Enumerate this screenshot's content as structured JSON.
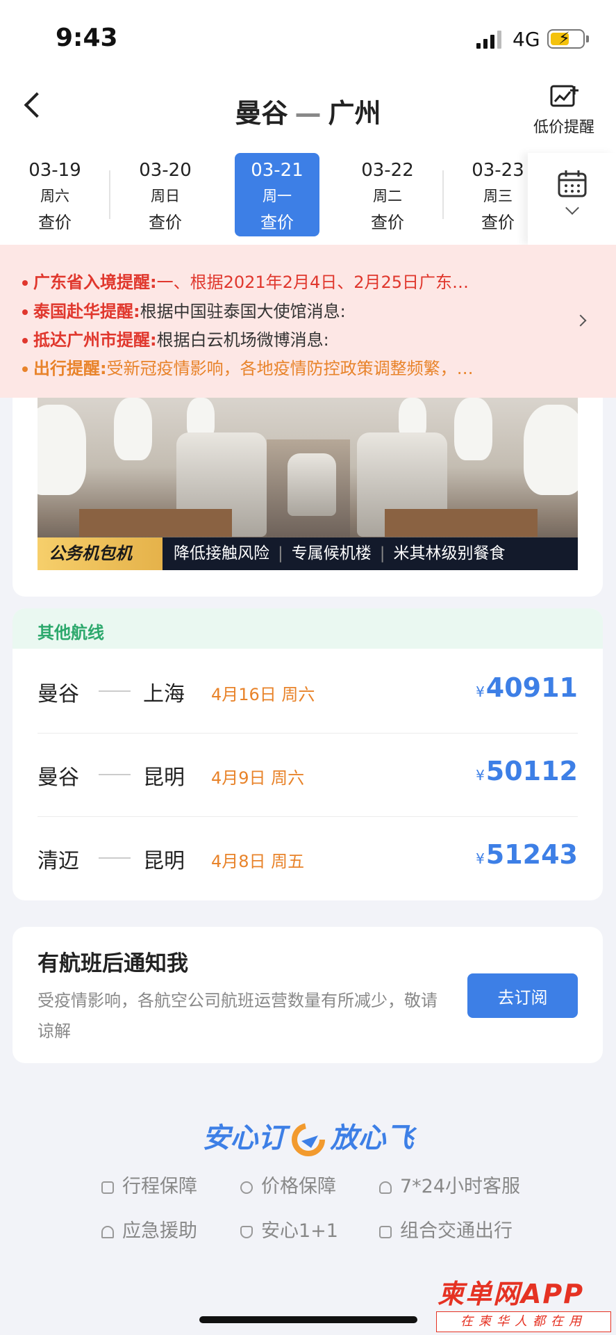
{
  "status_bar": {
    "time": "9:43",
    "network": "4G"
  },
  "header": {
    "from": "曼谷",
    "separator": "—",
    "to": "广州",
    "price_alert_label": "低价提醒"
  },
  "date_strip": [
    {
      "date": "03-19",
      "weekday": "周六",
      "price": "查价",
      "active": false
    },
    {
      "date": "03-20",
      "weekday": "周日",
      "price": "查价",
      "active": false
    },
    {
      "date": "03-21",
      "weekday": "周一",
      "price": "查价",
      "active": true
    },
    {
      "date": "03-22",
      "weekday": "周二",
      "price": "查价",
      "active": false
    },
    {
      "date": "03-23",
      "weekday": "周三",
      "price": "查价",
      "active": false
    }
  ],
  "notices": [
    {
      "title": "广东省入境提醒:",
      "body": "一、根据2021年2月4日、2月25日广东…",
      "color": "#e0372d"
    },
    {
      "title": "泰国赴华提醒:",
      "body": "根据中国驻泰国大使馆消息:",
      "color": "#e0372d"
    },
    {
      "title": "抵达广州市提醒:",
      "body": "根据白云机场微博消息:",
      "color": "#e0372d"
    },
    {
      "title": "出行提醒:",
      "body": "受新冠疫情影响，各地疫情防控政策调整频繁，…",
      "color": "#e8832a"
    }
  ],
  "jet_banner": {
    "tag": "公务机包机",
    "features": [
      "降低接触风险",
      "专属候机楼",
      "米其林级别餐食"
    ]
  },
  "other_routes": {
    "title": "其他航线",
    "routes": [
      {
        "from": "曼谷",
        "to": "上海",
        "date": "4月16日 周六",
        "currency": "¥",
        "price": "40911"
      },
      {
        "from": "曼谷",
        "to": "昆明",
        "date": "4月9日 周六",
        "currency": "¥",
        "price": "50112"
      },
      {
        "from": "清迈",
        "to": "昆明",
        "date": "4月8日 周五",
        "currency": "¥",
        "price": "51243"
      }
    ]
  },
  "notify": {
    "title": "有航班后通知我",
    "description": "受疫情影响，各航空公司航班运营数量有所减少，敬请谅解",
    "button": "去订阅"
  },
  "assurance": {
    "title_left": "安心订",
    "title_right": "放心飞",
    "items": [
      {
        "label": "行程保障",
        "icon": "briefcase-icon"
      },
      {
        "label": "价格保障",
        "icon": "yen-icon"
      },
      {
        "label": "7*24小时客服",
        "icon": "headset-icon"
      },
      {
        "label": "应急援助",
        "icon": "alarm-icon"
      },
      {
        "label": "安心1+1",
        "icon": "shield-icon"
      },
      {
        "label": "组合交通出行",
        "icon": "copy-icon"
      }
    ]
  },
  "watermark": {
    "brand": "柬单网",
    "suffix": "APP",
    "slogan": "在柬华人都在用"
  },
  "colors": {
    "accent": "#3d7fe6",
    "warning_red": "#e0372d",
    "warning_orange": "#e8832a",
    "success_green": "#2ca86c"
  }
}
